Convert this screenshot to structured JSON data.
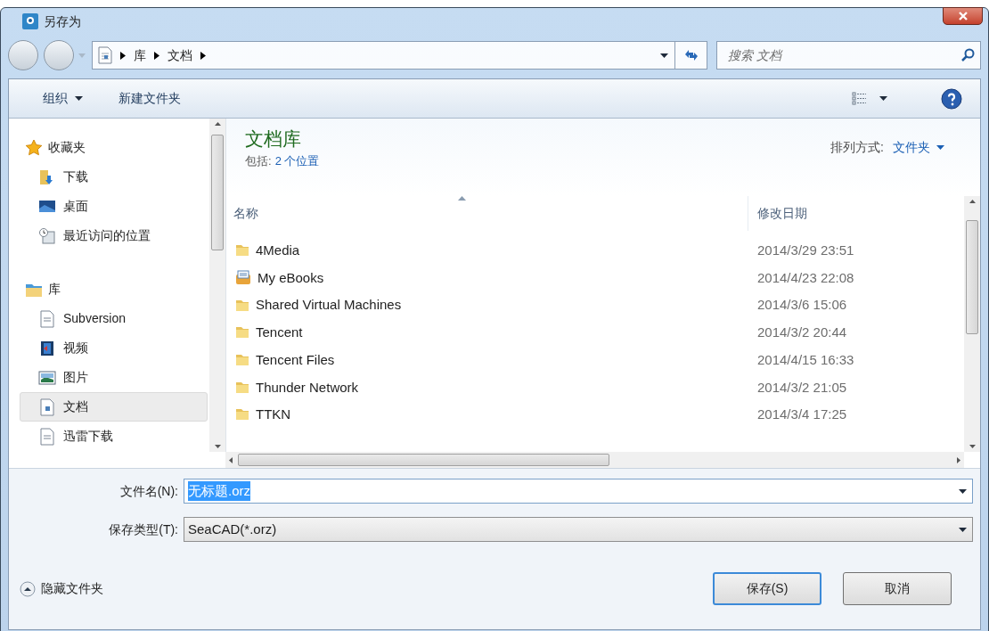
{
  "window": {
    "title": "另存为"
  },
  "nav": {
    "breadcrumb": [
      "库",
      "文档"
    ],
    "search": {
      "placeholder": "搜索 文档"
    }
  },
  "toolbar": {
    "buttons": [
      {
        "label": "组织",
        "kind": "menu"
      },
      {
        "label": "新建文件夹",
        "kind": "plain"
      }
    ]
  },
  "sidebar": {
    "groups": [
      {
        "label": "收藏夹",
        "items": [
          {
            "label": "下载",
            "selected": false
          },
          {
            "label": "桌面",
            "selected": false
          },
          {
            "label": "最近访问的位置",
            "selected": false
          }
        ]
      },
      {
        "label": "库",
        "items": [
          {
            "label": "Subversion",
            "selected": false
          },
          {
            "label": "视频",
            "selected": false
          },
          {
            "label": "图片",
            "selected": false
          },
          {
            "label": "文档",
            "selected": true
          },
          {
            "label": "迅雷下载",
            "selected": false
          }
        ]
      }
    ]
  },
  "library": {
    "title": "文档库",
    "includes_label": "包括:",
    "includes_link": "2 个位置",
    "arrange_label": "排列方式:",
    "arrange_value": "文件夹"
  },
  "table": {
    "columns": [
      "名称",
      "修改日期"
    ],
    "rows": [
      {
        "name": "4Media",
        "date": "2014/3/29 23:51",
        "kind": "folder"
      },
      {
        "name": "My eBooks",
        "date": "2014/4/23 22:08",
        "kind": "library"
      },
      {
        "name": "Shared Virtual Machines",
        "date": "2014/3/6 15:06",
        "kind": "folder"
      },
      {
        "name": "Tencent",
        "date": "2014/3/2 20:44",
        "kind": "folder"
      },
      {
        "name": "Tencent Files",
        "date": "2014/4/15 16:33",
        "kind": "folder"
      },
      {
        "name": "Thunder Network",
        "date": "2014/3/2 21:05",
        "kind": "folder"
      },
      {
        "name": "TTKN",
        "date": "2014/3/4 17:25",
        "kind": "folder"
      }
    ]
  },
  "form": {
    "filename_label": "文件名(N):",
    "filename_value": "无标题.orz",
    "filename_selected": true,
    "type_label": "保存类型(T):",
    "type_value": "SeaCAD(*.orz)"
  },
  "footer": {
    "toggle": "隐藏文件夹",
    "buttons": [
      {
        "label": "保存(S)",
        "kind": "default"
      },
      {
        "label": "取消",
        "kind": "normal"
      }
    ]
  }
}
